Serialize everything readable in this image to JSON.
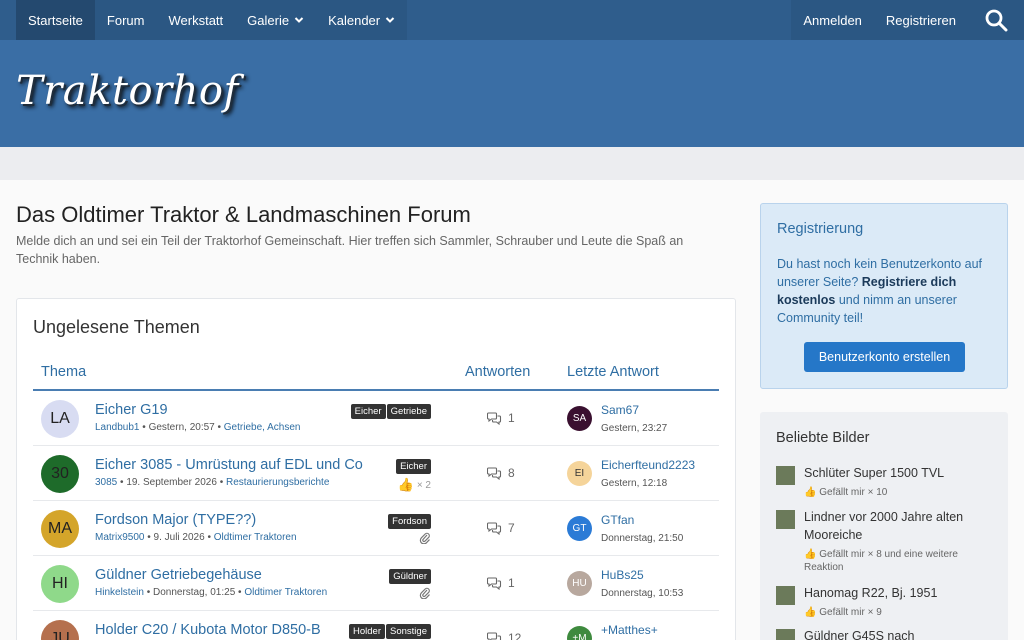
{
  "nav": {
    "items": [
      {
        "label": "Startseite",
        "active": true,
        "dropdown": false
      },
      {
        "label": "Forum",
        "active": false,
        "dropdown": false
      },
      {
        "label": "Werkstatt",
        "active": false,
        "dropdown": false
      },
      {
        "label": "Galerie",
        "active": false,
        "dropdown": true
      },
      {
        "label": "Kalender",
        "active": false,
        "dropdown": true
      }
    ],
    "login": "Anmelden",
    "register": "Registrieren"
  },
  "site": {
    "logo": "Traktorhof"
  },
  "page": {
    "title": "Das Oldtimer Traktor & Landmaschinen Forum",
    "description": "Melde dich an und sei ein Teil der Traktorhof Gemeinschaft. Hier treffen sich Sammler, Schrauber und Leute die Spaß an Technik haben."
  },
  "unread": {
    "title": "Ungelesene Themen",
    "columns": {
      "topic": "Thema",
      "replies": "Antworten",
      "last": "Letzte Antwort"
    },
    "rows": [
      {
        "initials": "LA",
        "avatar_color": "#d8dcf2",
        "title": "Eicher G19",
        "author": "Landbub1",
        "date": "Gestern, 20:57",
        "forum": "Getriebe, Achsen",
        "tags": [
          "Eicher",
          "Getriebe"
        ],
        "likes": "",
        "attachment": false,
        "replies": "1",
        "last_initials": "SA",
        "last_color": "#3a1030",
        "last_user": "Sam67",
        "last_time": "Gestern, 23:27"
      },
      {
        "initials": "30",
        "avatar_color": "#1e6b2a",
        "title": "Eicher 3085 - Umrüstung auf EDL und Co",
        "author": "3085",
        "date": "19. September 2026",
        "forum": "Restaurierungsberichte",
        "tags": [
          "Eicher"
        ],
        "likes": "× 2",
        "attachment": false,
        "replies": "8",
        "last_initials": "EI",
        "last_color": "#f5d49a",
        "last_user": "Eicherfteund2223",
        "last_time": "Gestern, 12:18"
      },
      {
        "initials": "MA",
        "avatar_color": "#d4a52a",
        "title": "Fordson Major (TYPE??)",
        "author": "Matrix9500",
        "date": "9. Juli 2026",
        "forum": "Oldtimer Traktoren",
        "tags": [
          "Fordson"
        ],
        "likes": "",
        "attachment": true,
        "replies": "7",
        "last_initials": "GT",
        "last_color": "#2b7bd6",
        "last_user": "GTfan",
        "last_time": "Donnerstag, 21:50"
      },
      {
        "initials": "HI",
        "avatar_color": "#8fd98a",
        "title": "Güldner Getriebegehäuse",
        "author": "Hinkelstein",
        "date": "Donnerstag, 01:25",
        "forum": "Oldtimer Traktoren",
        "tags": [
          "Güldner"
        ],
        "likes": "",
        "attachment": true,
        "replies": "1",
        "last_initials": "HU",
        "last_color": "#b8a89e",
        "last_user": "HuBs25",
        "last_time": "Donnerstag, 10:53"
      },
      {
        "initials": "JU",
        "avatar_color": "#b5704e",
        "title": "Holder C20 / Kubota Motor D850-B",
        "author": "",
        "date": "",
        "forum": "",
        "tags": [
          "Holder",
          "Sonstige"
        ],
        "likes": "",
        "attachment": false,
        "replies": "12",
        "last_initials": "+M",
        "last_color": "#3e8a3e",
        "last_user": "+Matthes+",
        "last_time": ""
      }
    ]
  },
  "sidebar": {
    "register": {
      "title": "Registrierung",
      "text_1": "Du hast noch kein Benutzerkonto auf unserer Seite? ",
      "text_bold": "Registriere dich kostenlos",
      "text_2": " und nimm an unserer Community teil!",
      "button": "Benutzerkonto erstellen"
    },
    "pictures": {
      "title": "Beliebte Bilder",
      "items": [
        {
          "name": "Schlüter Super 1500 TVL",
          "likes": "Gefällt mir × 10"
        },
        {
          "name": "Lindner vor 2000 Jahre alten Mooreiche",
          "likes": "Gefällt mir × 8 und eine weitere Reaktion"
        },
        {
          "name": "Hanomag R22, Bj. 1951",
          "likes": "Gefällt mir × 9"
        },
        {
          "name": "Güldner G45S nach",
          "likes": ""
        }
      ]
    }
  }
}
